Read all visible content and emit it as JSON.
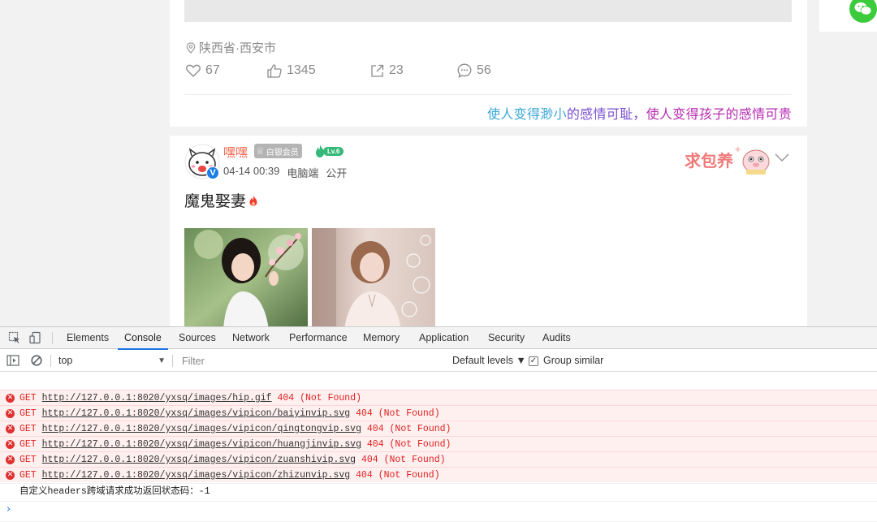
{
  "feed": {
    "post1": {
      "location": "陕西省·西安市",
      "stats": {
        "favorites": "67",
        "likes": "1345",
        "shares": "23",
        "comments": "56"
      },
      "slogan": {
        "part1": "使人变得渺小",
        "part2": "的感情可耻，",
        "part3": "使人变得孩子的感情可贵"
      }
    },
    "post2": {
      "username": "嘿嘿",
      "member_badge": "白银会员",
      "level": "Lv.6",
      "time": "04-14 00:39",
      "device": "电脑端",
      "visibility": "公开",
      "sticker_text": "求包养",
      "title": "魔鬼娶妻",
      "colors": {
        "username": "#f0644a",
        "verified": "#1a7ee6"
      }
    }
  },
  "devtools": {
    "tabs": [
      "Elements",
      "Console",
      "Sources",
      "Network",
      "Performance",
      "Memory",
      "Application",
      "Security",
      "Audits"
    ],
    "active_tab": "Console",
    "context": "top",
    "filter_placeholder": "Filter",
    "levels_label": "Default levels ▼",
    "group_similar_label": "Group similar",
    "group_similar_checked": true,
    "logs": [
      {
        "type": "error",
        "method": "GET",
        "url": "http://127.0.0.1:8020/yxsq/images/hip.gif",
        "status": "404 (Not Found)"
      },
      {
        "type": "error",
        "method": "GET",
        "url": "http://127.0.0.1:8020/yxsq/images/vipicon/baiyinvip.svg",
        "status": "404 (Not Found)"
      },
      {
        "type": "error",
        "method": "GET",
        "url": "http://127.0.0.1:8020/yxsq/images/vipicon/qingtongvip.svg",
        "status": "404 (Not Found)"
      },
      {
        "type": "error",
        "method": "GET",
        "url": "http://127.0.0.1:8020/yxsq/images/vipicon/huangjinvip.svg",
        "status": "404 (Not Found)"
      },
      {
        "type": "error",
        "method": "GET",
        "url": "http://127.0.0.1:8020/yxsq/images/vipicon/zuanshivip.svg",
        "status": "404 (Not Found)"
      },
      {
        "type": "error",
        "method": "GET",
        "url": "http://127.0.0.1:8020/yxsq/images/vipicon/zhizunvip.svg",
        "status": "404 (Not Found)"
      },
      {
        "type": "info",
        "text": "自定义headers跨域请求成功返回状态码：-1"
      }
    ],
    "prompt_symbol": "›"
  }
}
